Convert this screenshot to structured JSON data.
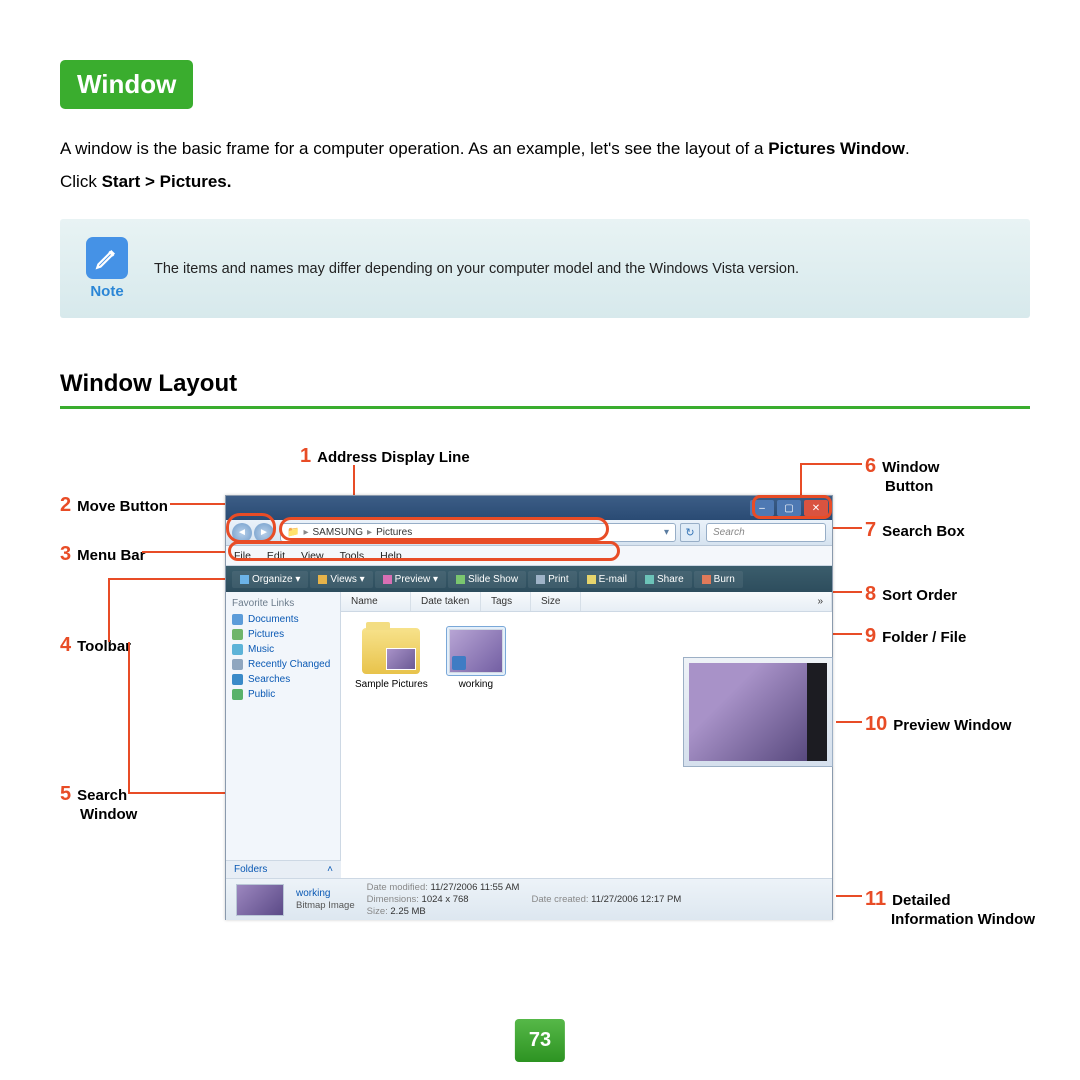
{
  "header": {
    "badge": "Window"
  },
  "intro": {
    "line1a": "A window is the basic frame for a computer operation. As an example, let's see the layout of a ",
    "line1b": "Pictures Window",
    "line1c": ".",
    "line2a": "Click ",
    "line2b": "Start > Pictures."
  },
  "note": {
    "label": "Note",
    "text": "The items and names may differ depending on your computer model and the Windows Vista version."
  },
  "section": {
    "title": "Window Layout"
  },
  "callouts": {
    "c1": "Address Display Line",
    "c2": "Move Button",
    "c3": "Menu Bar",
    "c4": "Toolbar",
    "c5a": "Search",
    "c5b": "Window",
    "c6a": "Window",
    "c6b": "Button",
    "c7": "Search Box",
    "c8": "Sort Order",
    "c9": "Folder / File",
    "c10": "Preview Window",
    "c11a": "Detailed",
    "c11b": "Information Window"
  },
  "win": {
    "breadcrumb": {
      "root": "▸",
      "p1": "SAMSUNG",
      "sep": "▸",
      "p2": "Pictures"
    },
    "search_placeholder": "Search",
    "menu": {
      "file": "File",
      "edit": "Edit",
      "view": "View",
      "tools": "Tools",
      "help": "Help"
    },
    "toolbar": {
      "organize": "Organize ▾",
      "views": "Views ▾",
      "preview": "Preview ▾",
      "slideshow": "Slide Show",
      "print": "Print",
      "email": "E-mail",
      "share": "Share",
      "burn": "Burn"
    },
    "sidebar": {
      "heading": "Favorite Links",
      "links": [
        "Documents",
        "Pictures",
        "Music",
        "Recently Changed",
        "Searches",
        "Public"
      ],
      "folders": "Folders"
    },
    "columns": [
      "Name",
      "Date taken",
      "Tags",
      "Size",
      "»"
    ],
    "files": {
      "f1": "Sample Pictures",
      "f2": "working"
    },
    "details": {
      "name": "working",
      "type": "Bitmap Image",
      "k_modified": "Date modified:",
      "v_modified": "11/27/2006 11:55 AM",
      "k_dim": "Dimensions:",
      "v_dim": "1024 x 768",
      "k_size": "Size:",
      "v_size": "2.25 MB",
      "k_created": "Date created:",
      "v_created": "11/27/2006 12:17 PM"
    }
  },
  "page_number": "73"
}
